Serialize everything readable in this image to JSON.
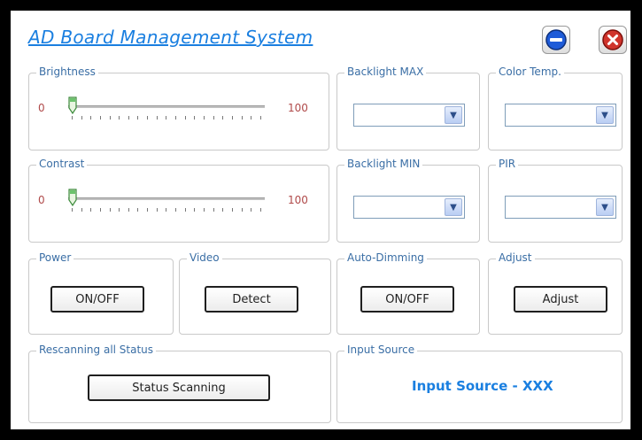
{
  "app": {
    "title": "AD Board Management System"
  },
  "titlebar": {
    "minimize_icon": "minimize-icon",
    "close_icon": "close-icon"
  },
  "brightness": {
    "label": "Brightness",
    "min": "0",
    "max": "100",
    "value": 0
  },
  "contrast": {
    "label": "Contrast",
    "min": "0",
    "max": "100",
    "value": 0
  },
  "backlight_max": {
    "label": "Backlight MAX",
    "selected": ""
  },
  "color_temp": {
    "label": "Color Temp.",
    "selected": ""
  },
  "backlight_min": {
    "label": "Backlight MIN",
    "selected": ""
  },
  "pir": {
    "label": "PIR",
    "selected": ""
  },
  "power": {
    "label": "Power",
    "button": "ON/OFF"
  },
  "video": {
    "label": "Video",
    "button": "Detect"
  },
  "auto_dimming": {
    "label": "Auto-Dimming",
    "button": "ON/OFF"
  },
  "adjust": {
    "label": "Adjust",
    "button": "Adjust"
  },
  "rescan": {
    "label": "Rescanning all Status",
    "button": "Status Scanning"
  },
  "input_source": {
    "label": "Input Source",
    "value": "Input Source - XXX"
  },
  "colors": {
    "accent": "#1a7fe0",
    "slider_value": "#b04a4a"
  }
}
